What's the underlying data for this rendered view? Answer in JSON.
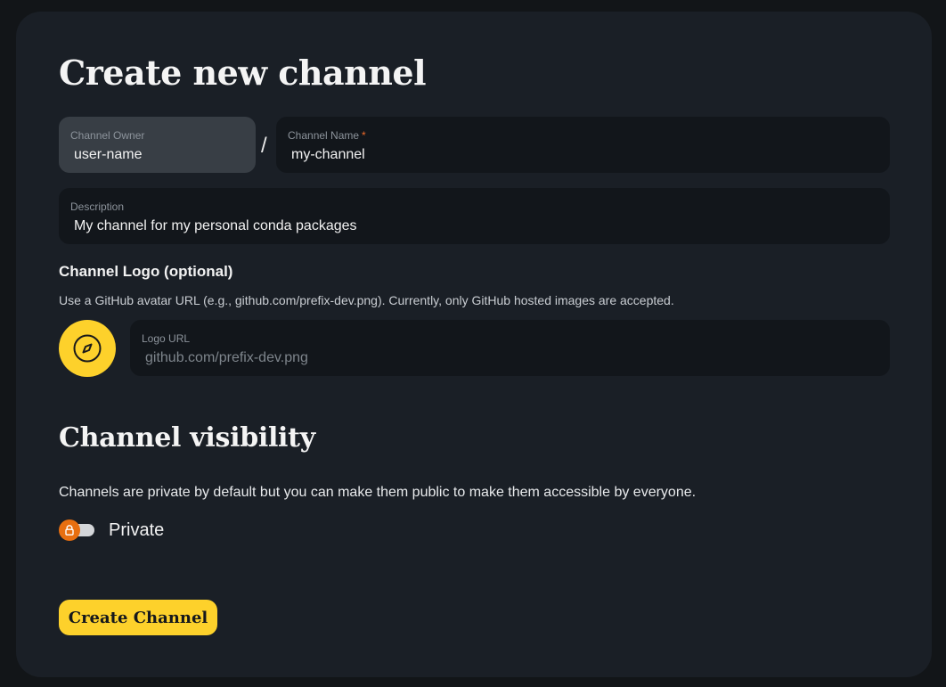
{
  "form": {
    "title": "Create new channel",
    "owner": {
      "label": "Channel Owner",
      "value": "user-name"
    },
    "separator": "/",
    "name": {
      "label": "Channel Name",
      "required_mark": "*",
      "value": "my-channel"
    },
    "description": {
      "label": "Description",
      "value": "My channel for my personal conda packages"
    }
  },
  "logo": {
    "heading": "Channel Logo (optional)",
    "help": "Use a GitHub avatar URL (e.g., github.com/prefix-dev.png). Currently, only GitHub hosted images are accepted.",
    "avatar_icon": "compass-icon",
    "field_label": "Logo URL",
    "placeholder": "github.com/prefix-dev.png",
    "value": ""
  },
  "visibility": {
    "title": "Channel visibility",
    "description": "Channels are private by default but you can make them public to make them accessible by everyone.",
    "toggle_label": "Private",
    "toggle_icon": "lock-icon",
    "is_public": false
  },
  "actions": {
    "create_label": "Create Channel"
  },
  "colors": {
    "background": "#121518",
    "card": "#1a1f26",
    "accent": "#fdd12b",
    "required": "#f06a2a",
    "lock": "#e86f10"
  }
}
